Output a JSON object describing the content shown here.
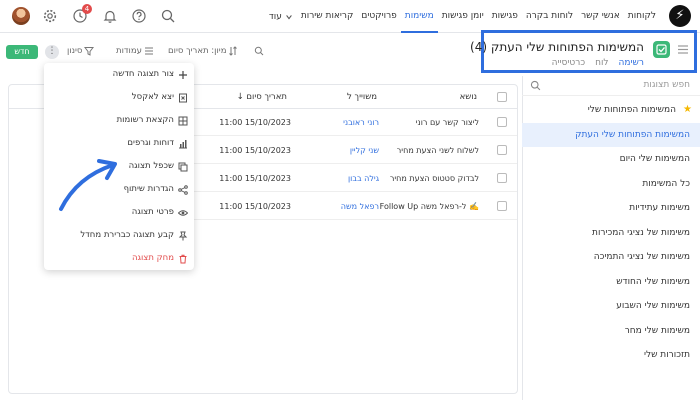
{
  "nav": {
    "logo": "⚡",
    "items": [
      "לקוחות",
      "אנשי קשר",
      "לוחות בקרה",
      "פגישות",
      "יומן פגישות",
      "משימות",
      "פרויקטים",
      "קריאות שירות"
    ],
    "active_index": 5,
    "more_label": "עוד",
    "notification_count": "4"
  },
  "view_header": {
    "title": "המשימות הפתוחות שלי העתק (4)",
    "tabs": [
      "רשימה",
      "לוח",
      "כרטיסייה"
    ]
  },
  "sidebar": {
    "search_placeholder": "חפש תצוגות",
    "items": [
      "המשימות הפתוחות שלי",
      "המשימות הפתוחות שלי העתק",
      "המשימות שלי היום",
      "כל המשימות",
      "משימות עתידיות",
      "משימות של נציגי המכירות",
      "משימות של נציגי התמיכה",
      "משימות שלי החודש",
      "משימות שלי השבוע",
      "משימות שלי מחר",
      "תזכורות שלי"
    ]
  },
  "toolbar": {
    "new_label": "חדש",
    "filter_label": "סינון",
    "columns_label": "עמודות",
    "sort_label": "מיון: תאריך סיום"
  },
  "table": {
    "headers": {
      "subject": "נושא",
      "owner": "משוייך ל",
      "due": "↓ תאריך סיום"
    },
    "rows": [
      {
        "subject": "ליצור קשר עם רוני",
        "owner": "רוני ראובני",
        "due": "11:00 15/10/2023"
      },
      {
        "subject": "לשלוח לשני הצעת מחיר",
        "owner": "שני קליין",
        "due": "11:00 15/10/2023"
      },
      {
        "subject": "לבדוק סטטוס הצעת מחיר",
        "owner": "גילה בבון",
        "due": "11:00 15/10/2023"
      },
      {
        "subject": "Follow Up ל-רפאל משה ✍️",
        "owner": "רפאל משה",
        "due": "11:00 15/10/2023"
      }
    ]
  },
  "menu": {
    "items": [
      {
        "label": "צור תצוגה חדשה",
        "icon": "plus-icon"
      },
      {
        "label": "יצא לאקסל",
        "icon": "excel-icon"
      },
      {
        "label": "הקצאת רשומות",
        "icon": "grid-icon"
      },
      {
        "label": "דוחות וגרפים",
        "icon": "chart-icon"
      },
      {
        "label": "שכפל תצוגה",
        "icon": "duplicate-icon"
      },
      {
        "label": "הגדרות שיתוף",
        "icon": "share-icon"
      },
      {
        "label": "פרטי תצוגה",
        "icon": "eye-icon"
      },
      {
        "label": "קבע תצוגה כברירת מחדל",
        "icon": "pin-icon"
      },
      {
        "label": "מחק תצוגה",
        "icon": "trash-icon"
      }
    ]
  },
  "colors": {
    "accent": "#2f6ede",
    "new_button": "#3cb878",
    "danger": "#e24b4b",
    "highlight_border": "#2f6ede"
  }
}
